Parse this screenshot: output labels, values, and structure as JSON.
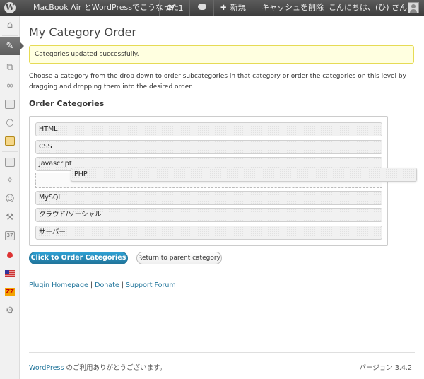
{
  "adminbar": {
    "site_name": "MacBook Air とWordPressでこうなった",
    "updates_count": "1",
    "new_label": "新規",
    "cache_label": "キャッシュを削除",
    "greeting": "こんにちは、(ひ) さん!"
  },
  "page": {
    "title": "My Category Order",
    "notice": "Categories updated successfully.",
    "intro": "Choose a category from the drop down to order subcategories in that category or order the categories on this level by dragging and dropping them into the desired order.",
    "section_title": "Order Categories"
  },
  "categories": [
    "HTML",
    "CSS",
    "Javascript",
    "PHP",
    "MySQL",
    "クラウド/ソーシャル",
    "サーバー"
  ],
  "buttons": {
    "order": "Click to Order Categories",
    "return": "Return to parent category"
  },
  "links": {
    "homepage": "Plugin Homepage",
    "donate": "Donate",
    "forum": "Support Forum",
    "separator": "|"
  },
  "footer": {
    "wordpress_link": "WordPress",
    "thanks": " のご利用ありがとうございます。",
    "version": "バージョン 3.4.2"
  },
  "icons": {
    "wp_logo": "W",
    "refresh": "⟳",
    "comment": "💬",
    "plus": "✚"
  }
}
